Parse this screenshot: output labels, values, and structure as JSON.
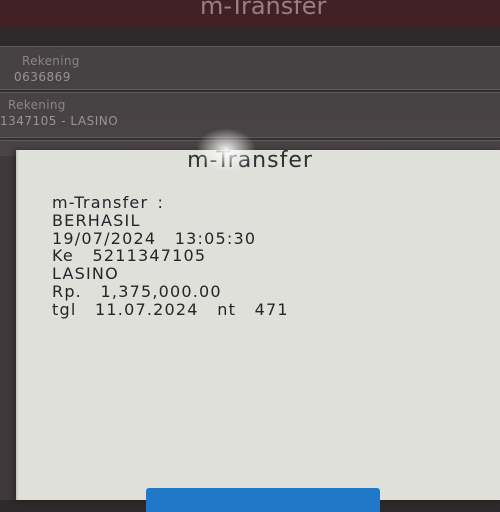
{
  "background": {
    "title": "m-Transfer",
    "rows": [
      {
        "label": "Rekening",
        "value": "0636869"
      },
      {
        "label": "Rekening",
        "value": "1347105 - LASINO"
      }
    ]
  },
  "dialog": {
    "title": "m-Transfer",
    "lines": [
      "m-Transfer :",
      "BERHASIL",
      "19/07/2024  13:05:30",
      "Ke  5211347105",
      "LASINO",
      "Rp.  1,375,000.00",
      "tgl  11.07.2024  nt  471"
    ]
  },
  "colors": {
    "dialog_bg": "#dfe0da",
    "button": "#1f78c8",
    "text": "#23252a"
  }
}
